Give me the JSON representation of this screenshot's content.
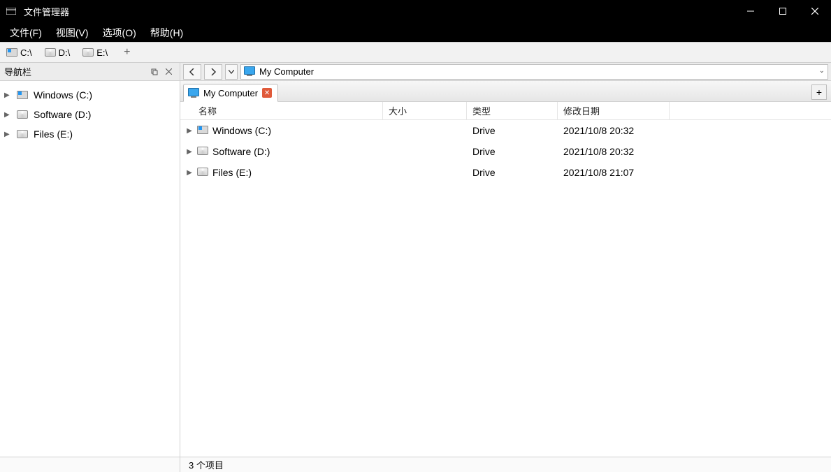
{
  "window": {
    "title": "文件管理器"
  },
  "menu": {
    "file": "文件(F)",
    "view": "视图(V)",
    "options": "选项(O)",
    "help": "帮助(H)"
  },
  "drives_toolbar": {
    "c": "C:\\",
    "d": "D:\\",
    "e": "E:\\",
    "add": "+"
  },
  "sidebar": {
    "title": "导航栏",
    "items": [
      {
        "label": "Windows (C:)",
        "icon": "c"
      },
      {
        "label": "Software (D:)",
        "icon": "d"
      },
      {
        "label": "Files (E:)",
        "icon": "d"
      }
    ]
  },
  "address": {
    "path": "My Computer"
  },
  "tabs": {
    "active": {
      "label": "My Computer"
    },
    "add": "+"
  },
  "columns": {
    "name": "名称",
    "size": "大小",
    "type": "类型",
    "date": "修改日期"
  },
  "rows": [
    {
      "name": "Windows (C:)",
      "size": "",
      "type": "Drive",
      "date": "2021/10/8 20:32",
      "icon": "c"
    },
    {
      "name": "Software (D:)",
      "size": "",
      "type": "Drive",
      "date": "2021/10/8 20:32",
      "icon": "d"
    },
    {
      "name": "Files (E:)",
      "size": "",
      "type": "Drive",
      "date": "2021/10/8 21:07",
      "icon": "d"
    }
  ],
  "status": {
    "msg": "3 个项目"
  }
}
